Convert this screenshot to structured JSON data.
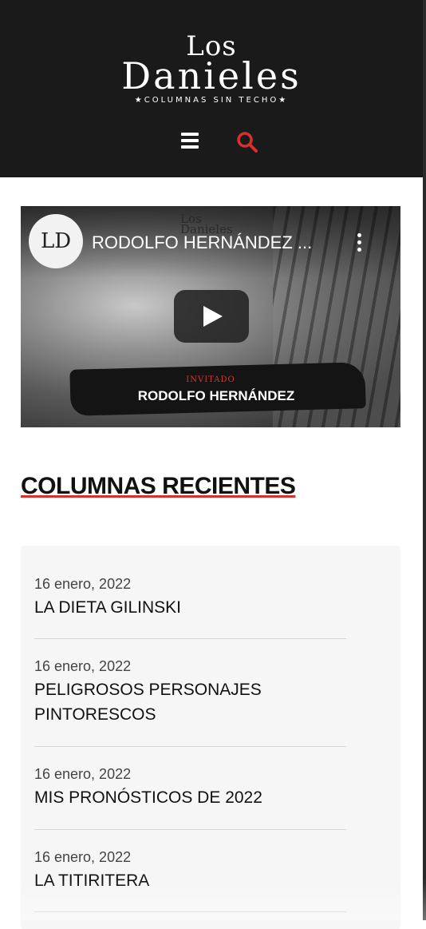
{
  "header": {
    "logo": {
      "line1": "Los",
      "line2": "Danieles",
      "tagline": "★COLUMNAS SIN TECHO★"
    },
    "menu_icon": "hamburger-menu-icon",
    "search_icon": "magnifier-search-icon",
    "search_color": "#d8302c",
    "background": "#1a1a1a"
  },
  "video": {
    "channel_initials": "LD",
    "title": "RODOLFO HERNÁNDEZ ...",
    "watermark_line1": "Los",
    "watermark_line2": "Danieles",
    "guest_label": "INVITADO",
    "guest_name": "RODOLFO HERNÁNDEZ",
    "play_icon": "play-icon",
    "more_icon": "more-vertical-icon"
  },
  "section": {
    "title": "COLUMNAS RECIENTES",
    "accent_color": "#d8302c"
  },
  "columns": [
    {
      "date": "16 enero, 2022",
      "title": "LA DIETA GILINSKI"
    },
    {
      "date": "16 enero, 2022",
      "title": "PELIGROSOS PERSONAJES PINTORESCOS"
    },
    {
      "date": "16 enero, 2022",
      "title": "MIS PRONÓSTICOS DE 2022"
    },
    {
      "date": "16 enero, 2022",
      "title": "LA TITIRITERA"
    }
  ]
}
